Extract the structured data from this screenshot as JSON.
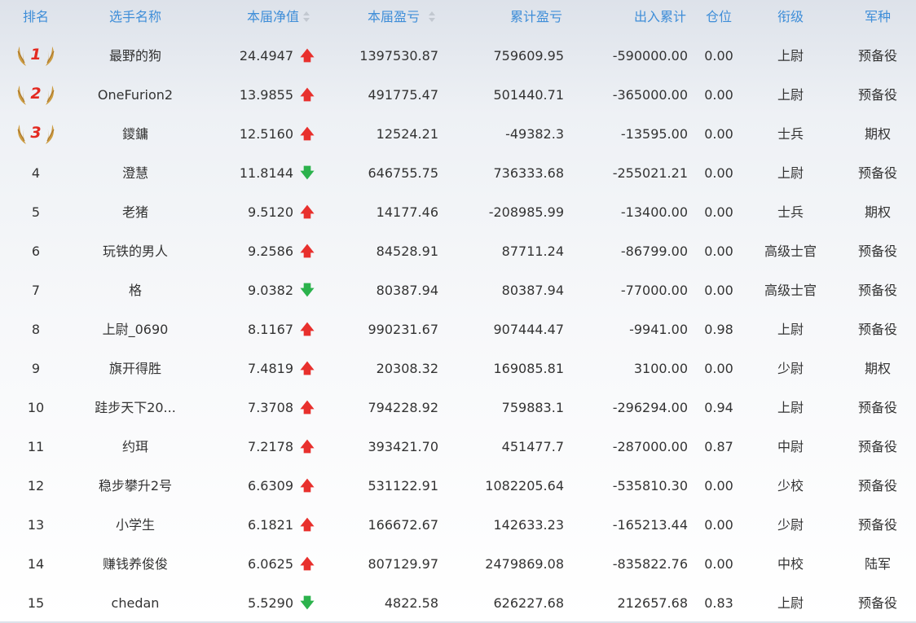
{
  "headers": {
    "rank": "排名",
    "name": "选手名称",
    "nav": "本届净值",
    "pnl": "本届盈亏",
    "cum": "累计盈亏",
    "io": "出入累计",
    "pos": "仓位",
    "level": "衔级",
    "type": "军种"
  },
  "colors": {
    "header_text": "#3f8ed8",
    "up": "#e8302d",
    "down": "#2bb24c",
    "medal": "#c9932f",
    "medal_number": "#e32a21"
  },
  "rows": [
    {
      "rank": "1",
      "name": "最野的狗",
      "nav": "24.4947",
      "trend": "up",
      "pnl": "1397530.87",
      "cum": "759609.95",
      "io": "-590000.00",
      "pos": "0.00",
      "level": "上尉",
      "type": "预备役",
      "medal": true
    },
    {
      "rank": "2",
      "name": "OneFurion2",
      "nav": "13.9855",
      "trend": "up",
      "pnl": "491775.47",
      "cum": "501440.71",
      "io": "-365000.00",
      "pos": "0.00",
      "level": "上尉",
      "type": "预备役",
      "medal": true
    },
    {
      "rank": "3",
      "name": "鑁鏞",
      "nav": "12.5160",
      "trend": "up",
      "pnl": "12524.21",
      "cum": "-49382.3",
      "io": "-13595.00",
      "pos": "0.00",
      "level": "士兵",
      "type": "期权",
      "medal": true
    },
    {
      "rank": "4",
      "name": "澄慧",
      "nav": "11.8144",
      "trend": "down",
      "pnl": "646755.75",
      "cum": "736333.68",
      "io": "-255021.21",
      "pos": "0.00",
      "level": "上尉",
      "type": "预备役",
      "medal": false
    },
    {
      "rank": "5",
      "name": "老猪",
      "nav": "9.5120",
      "trend": "up",
      "pnl": "14177.46",
      "cum": "-208985.99",
      "io": "-13400.00",
      "pos": "0.00",
      "level": "士兵",
      "type": "期权",
      "medal": false
    },
    {
      "rank": "6",
      "name": "玩铁的男人",
      "nav": "9.2586",
      "trend": "up",
      "pnl": "84528.91",
      "cum": "87711.24",
      "io": "-86799.00",
      "pos": "0.00",
      "level": "高级士官",
      "type": "预备役",
      "medal": false
    },
    {
      "rank": "7",
      "name": "格",
      "nav": "9.0382",
      "trend": "down",
      "pnl": "80387.94",
      "cum": "80387.94",
      "io": "-77000.00",
      "pos": "0.00",
      "level": "高级士官",
      "type": "预备役",
      "medal": false
    },
    {
      "rank": "8",
      "name": "上尉_0690",
      "nav": "8.1167",
      "trend": "up",
      "pnl": "990231.67",
      "cum": "907444.47",
      "io": "-9941.00",
      "pos": "0.98",
      "level": "上尉",
      "type": "预备役",
      "medal": false
    },
    {
      "rank": "9",
      "name": "旗开得胜",
      "nav": "7.4819",
      "trend": "up",
      "pnl": "20308.32",
      "cum": "169085.81",
      "io": "3100.00",
      "pos": "0.00",
      "level": "少尉",
      "type": "期权",
      "medal": false
    },
    {
      "rank": "10",
      "name": "跬步天下20...",
      "nav": "7.3708",
      "trend": "up",
      "pnl": "794228.92",
      "cum": "759883.1",
      "io": "-296294.00",
      "pos": "0.94",
      "level": "上尉",
      "type": "预备役",
      "medal": false
    },
    {
      "rank": "11",
      "name": "约珥",
      "nav": "7.2178",
      "trend": "up",
      "pnl": "393421.70",
      "cum": "451477.7",
      "io": "-287000.00",
      "pos": "0.87",
      "level": "中尉",
      "type": "预备役",
      "medal": false
    },
    {
      "rank": "12",
      "name": "稳步攀升2号",
      "nav": "6.6309",
      "trend": "up",
      "pnl": "531122.91",
      "cum": "1082205.64",
      "io": "-535810.30",
      "pos": "0.00",
      "level": "少校",
      "type": "预备役",
      "medal": false
    },
    {
      "rank": "13",
      "name": "小学生",
      "nav": "6.1821",
      "trend": "up",
      "pnl": "166672.67",
      "cum": "142633.23",
      "io": "-165213.44",
      "pos": "0.00",
      "level": "少尉",
      "type": "预备役",
      "medal": false
    },
    {
      "rank": "14",
      "name": "赚钱养俊俊",
      "nav": "6.0625",
      "trend": "up",
      "pnl": "807129.97",
      "cum": "2479869.08",
      "io": "-835822.76",
      "pos": "0.00",
      "level": "中校",
      "type": "陆军",
      "medal": false
    },
    {
      "rank": "15",
      "name": "chedan",
      "nav": "5.5290",
      "trend": "down",
      "pnl": "4822.58",
      "cum": "626227.68",
      "io": "212657.68",
      "pos": "0.83",
      "level": "上尉",
      "type": "预备役",
      "medal": false
    }
  ]
}
